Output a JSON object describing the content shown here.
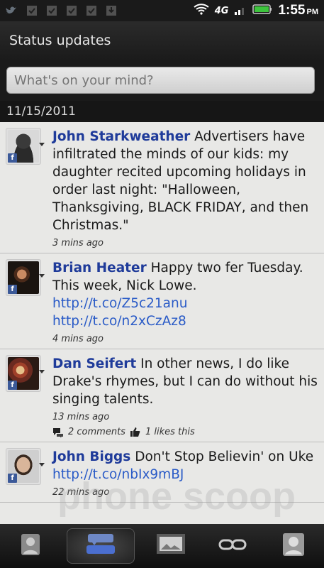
{
  "status_bar": {
    "network": "4G",
    "time": "1:55",
    "ampm": "PM"
  },
  "header": {
    "title": "Status updates"
  },
  "compose": {
    "placeholder": "What's on your mind?"
  },
  "date": "11/15/2011",
  "posts": [
    {
      "name": "John Starkweather",
      "text": "Advertisers have infiltrated the minds of our kids: my daughter recited upcoming holidays in order last night: \"Halloween, Thanksgiving, BLACK FRIDAY, and then Christmas.\"",
      "time": "3 mins ago"
    },
    {
      "name": "Brian Heater",
      "text": "Happy two fer Tuesday. This week, Nick Lowe.",
      "link1": "http://t.co/Z5c21anu",
      "link2": "http://t.co/n2xCzAz8",
      "time": "4 mins ago"
    },
    {
      "name": "Dan Seifert",
      "text": "In other news, I do like Drake's rhymes, but I can do without his singing talents.",
      "time": "13 mins ago",
      "comments": "2 comments",
      "likes": "1 likes this"
    },
    {
      "name": "John Biggs",
      "text": "Don't Stop Believin' on Uke",
      "link1": "http://t.co/nbIx9mBJ",
      "time": "22 mins ago"
    }
  ],
  "watermark": "phone scoop",
  "icons": {
    "facebook": "facebook-icon",
    "comment": "comment-icon",
    "like": "thumbs-up-icon"
  },
  "colors": {
    "name": "#1f3b9a",
    "link": "#2a5bc7",
    "facebook": "#3b5998"
  }
}
